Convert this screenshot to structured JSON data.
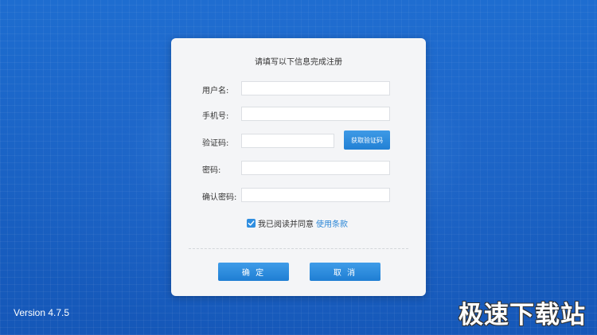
{
  "dialog": {
    "title": "请填写以下信息完成注册",
    "fields": [
      {
        "label": "用户名:",
        "value": "",
        "placeholder": ""
      },
      {
        "label": "手机号:",
        "value": "",
        "placeholder": ""
      },
      {
        "label": "验证码:",
        "value": "",
        "placeholder": ""
      },
      {
        "label": "密码:",
        "value": "",
        "placeholder": ""
      },
      {
        "label": "确认密码:",
        "value": "",
        "placeholder": ""
      }
    ],
    "get_code_label": "获取验证码",
    "agree_checked": true,
    "agree_text": "我已阅读并同意",
    "terms_link": "使用条款",
    "ok_label": "确 定",
    "cancel_label": "取 消"
  },
  "footer": {
    "version": "Version 4.7.5"
  },
  "watermark": "极速下载站",
  "icons": {
    "checkbox": "checkmark-icon"
  },
  "colors": {
    "background": "#1a63c4",
    "dialog": "#f4f5f7",
    "accent": "#2a86d6",
    "button": "#2280d4"
  }
}
